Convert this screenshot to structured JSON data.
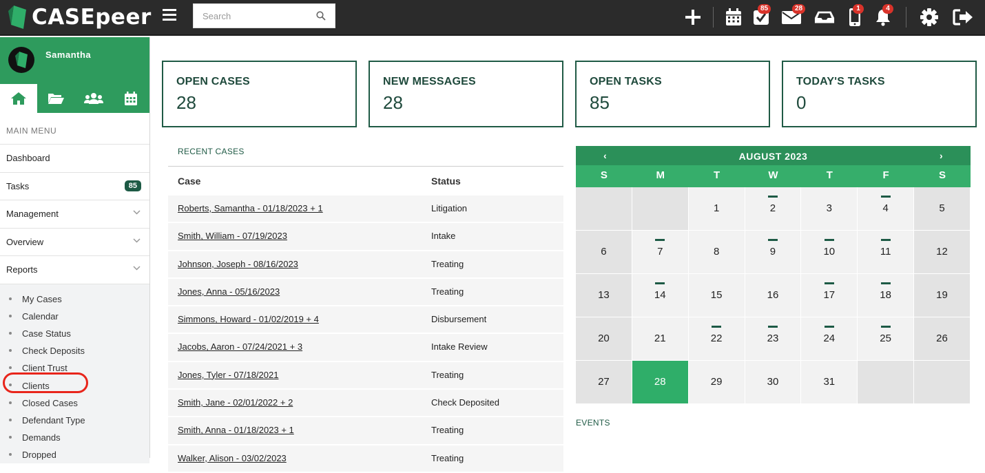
{
  "app": {
    "brand": "CASEpeer"
  },
  "search": {
    "placeholder": "Search"
  },
  "topbar": {
    "icons": [
      "plus-icon",
      "calendar-icon",
      "tasks-icon",
      "mail-icon",
      "inbox-icon",
      "phone-icon",
      "bell-icon",
      "gear-icon",
      "logout-icon"
    ],
    "badges": {
      "tasks": "85",
      "mail": "28",
      "phone": "1",
      "bell": "4"
    }
  },
  "sidebar": {
    "user": "Samantha",
    "tabs": [
      "home-icon",
      "folder-icon",
      "users-icon",
      "calendar-icon"
    ],
    "menu_head": "MAIN MENU",
    "items": [
      {
        "label": "Dashboard"
      },
      {
        "label": "Tasks",
        "badge": "85"
      },
      {
        "label": "Management"
      },
      {
        "label": "Overview"
      },
      {
        "label": "Reports"
      }
    ],
    "reports": [
      "My Cases",
      "Calendar",
      "Case Status",
      "Check Deposits",
      "Client Trust",
      "Clients",
      "Closed Cases",
      "Defendant Type",
      "Demands",
      "Dropped"
    ]
  },
  "stats": [
    {
      "title": "OPEN CASES",
      "value": "28"
    },
    {
      "title": "NEW MESSAGES",
      "value": "28"
    },
    {
      "title": "OPEN TASKS",
      "value": "85"
    },
    {
      "title": "TODAY'S TASKS",
      "value": "0"
    }
  ],
  "recent": {
    "title": "RECENT CASES",
    "col_case": "Case",
    "col_status": "Status",
    "rows": [
      {
        "case": "Roberts, Samantha - 01/18/2023 + 1",
        "status": "Litigation"
      },
      {
        "case": "Smith, William - 07/19/2023",
        "status": "Intake"
      },
      {
        "case": "Johnson, Joseph - 08/16/2023",
        "status": "Treating"
      },
      {
        "case": "Jones, Anna - 05/16/2023",
        "status": "Treating"
      },
      {
        "case": "Simmons, Howard - 01/02/2019 + 4",
        "status": "Disbursement"
      },
      {
        "case": "Jacobs, Aaron - 07/24/2021 + 3",
        "status": "Intake Review"
      },
      {
        "case": "Jones, Tyler - 07/18/2021",
        "status": "Treating"
      },
      {
        "case": "Smith, Jane - 02/01/2022 + 2",
        "status": "Check Deposited"
      },
      {
        "case": "Smith, Anna - 01/18/2023 + 1",
        "status": "Treating"
      },
      {
        "case": "Walker, Alison - 03/02/2023",
        "status": "Treating"
      }
    ]
  },
  "calendar": {
    "title": "AUGUST 2023",
    "prev": "‹",
    "next": "›",
    "dow": [
      "S",
      "M",
      "T",
      "W",
      "T",
      "F",
      "S"
    ],
    "weeks": [
      [
        "",
        "",
        "1",
        "2",
        "3",
        "4",
        "5"
      ],
      [
        "6",
        "7",
        "8",
        "9",
        "10",
        "11",
        "12"
      ],
      [
        "13",
        "14",
        "15",
        "16",
        "17",
        "18",
        "19"
      ],
      [
        "20",
        "21",
        "22",
        "23",
        "24",
        "25",
        "26"
      ],
      [
        "27",
        "28",
        "29",
        "30",
        "31",
        "",
        ""
      ]
    ],
    "marked_days": [
      "2",
      "4",
      "7",
      "9",
      "10",
      "11",
      "14",
      "17",
      "18",
      "22",
      "23",
      "24",
      "25"
    ],
    "today": "28",
    "events_title": "EVENTS"
  },
  "colors": {
    "brand_green": "#2e9b5d",
    "dark_green": "#1f5a45",
    "topbar": "#2b2b2b",
    "badge_red": "#d9332a",
    "highlight": "#e8251b"
  }
}
